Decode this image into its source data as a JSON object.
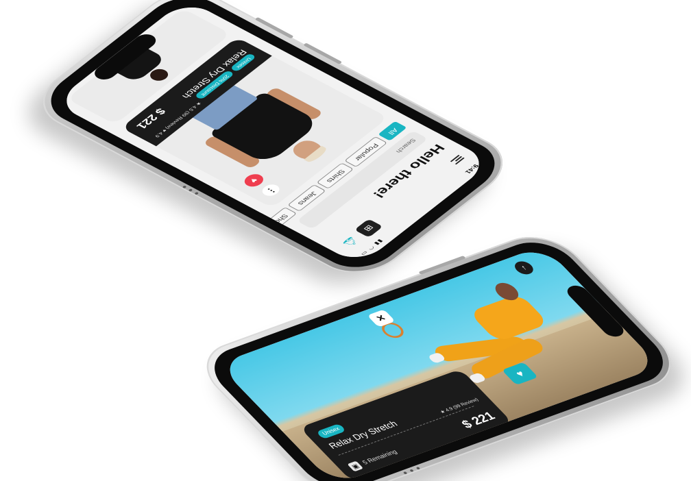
{
  "list_screen": {
    "status_time": "9:41",
    "status_icons": "▮▮ ◠ ▭",
    "greeting": "Hello there!",
    "search_placeholder": "Search",
    "categories": [
      "All",
      "Popular",
      "Shirts",
      "Jeans",
      "Shoes"
    ],
    "active_category": "All",
    "product": {
      "tags": [
        "Unisex",
        "20% Discount"
      ],
      "name": "Relax Dry Stretch",
      "rating": "★ 4.5 (99 Review)",
      "likes": "♥ 4.9",
      "price": "$ 221"
    },
    "icons": {
      "menu": "menu-icon",
      "cart": "cart-icon",
      "bell": "bell-icon",
      "more": "more-icon",
      "favorite": "heart-icon"
    }
  },
  "detail_screen": {
    "tag": "Unisex",
    "name": "Relax Dry Stretch",
    "remaining": "5 Remaining",
    "rating": "★ 4.9 (99 Review)",
    "price": "$ 221",
    "icons": {
      "back": "arrow-up-icon",
      "close": "close-icon",
      "favorite": "heart-icon",
      "stock": "box-icon"
    }
  },
  "colors": {
    "accent": "#19b5c2",
    "favorite": "#ef3e4f",
    "dark_panel": "#1b1b1b"
  }
}
